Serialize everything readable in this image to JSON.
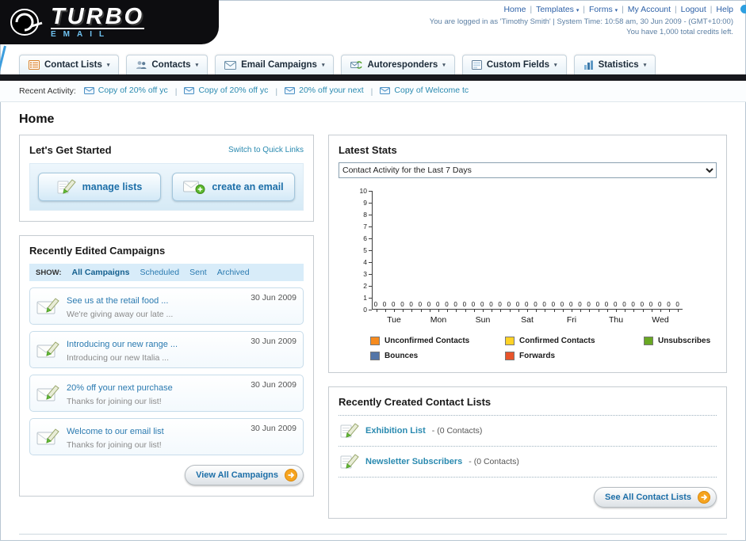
{
  "page_title": "Home",
  "header": {
    "logo_title": "TURBO",
    "logo_subtitle": "EMAIL",
    "nav_links": [
      {
        "label": "Home",
        "dropdown": false
      },
      {
        "label": "Templates",
        "dropdown": true
      },
      {
        "label": "Forms",
        "dropdown": true
      },
      {
        "label": "My Account",
        "dropdown": false
      },
      {
        "label": "Logout",
        "dropdown": false
      },
      {
        "label": "Help",
        "dropdown": false
      }
    ],
    "login_info": "You are logged in as 'Timothy Smith' | System Time: 10:58 am, 30 Jun 2009 - (GMT+10:00)",
    "credits_info": "You have 1,000 total credits left."
  },
  "nav_tabs": [
    {
      "label": "Contact Lists",
      "icon": "contact-lists-icon"
    },
    {
      "label": "Contacts",
      "icon": "contacts-icon"
    },
    {
      "label": "Email Campaigns",
      "icon": "email-campaigns-icon"
    },
    {
      "label": "Autoresponders",
      "icon": "autoresponders-icon"
    },
    {
      "label": "Custom Fields",
      "icon": "custom-fields-icon"
    },
    {
      "label": "Statistics",
      "icon": "statistics-icon"
    }
  ],
  "recent_activity": {
    "label": "Recent Activity:",
    "items": [
      {
        "label": "Copy of 20% off yc",
        "icon": "email-icon"
      },
      {
        "label": "Copy of 20% off yc",
        "icon": "email-icon"
      },
      {
        "label": "20% off your next",
        "icon": "email-icon"
      },
      {
        "label": "Copy of Welcome tc",
        "icon": "email-icon"
      }
    ]
  },
  "get_started": {
    "title": "Let's Get Started",
    "switch_link": "Switch to Quick Links",
    "buttons": [
      {
        "label": "manage lists",
        "icon": "pencil-list-icon"
      },
      {
        "label": "create an email",
        "icon": "envelope-plus-icon"
      }
    ]
  },
  "campaigns": {
    "title": "Recently Edited Campaigns",
    "show_label": "SHOW:",
    "filters": [
      {
        "label": "All Campaigns",
        "active": true
      },
      {
        "label": "Scheduled",
        "active": false
      },
      {
        "label": "Sent",
        "active": false
      },
      {
        "label": "Archived",
        "active": false
      }
    ],
    "items": [
      {
        "title": "See us at the retail food ...",
        "subtitle": "We're giving away our late ...",
        "date": "30 Jun 2009",
        "icon": "envelope-pencil-icon"
      },
      {
        "title": "Introducing our new range ...",
        "subtitle": "Introducing our new Italia ...",
        "date": "30 Jun 2009",
        "icon": "envelope-pencil-icon"
      },
      {
        "title": "20% off your next purchase",
        "subtitle": "Thanks for joining our list!",
        "date": "30 Jun 2009",
        "icon": "envelope-pencil-icon"
      },
      {
        "title": "Welcome to our email list",
        "subtitle": "Thanks for joining our list!",
        "date": "30 Jun 2009",
        "icon": "envelope-pencil-icon"
      }
    ],
    "view_all_label": "View All Campaigns"
  },
  "stats": {
    "title": "Latest Stats",
    "period_selected": "Contact Activity for the Last 7 Days"
  },
  "chart_data": {
    "type": "bar",
    "title": "Contact Activity for the Last 7 Days",
    "categories": [
      "Tue",
      "Mon",
      "Sun",
      "Sat",
      "Fri",
      "Thu",
      "Wed"
    ],
    "series": [
      {
        "name": "Unconfirmed Contacts",
        "color": "#f68b1f",
        "values": [
          0,
          0,
          0,
          0,
          0,
          0,
          0
        ]
      },
      {
        "name": "Confirmed Contacts",
        "color": "#ffd226",
        "values": [
          0,
          0,
          0,
          0,
          0,
          0,
          0
        ]
      },
      {
        "name": "Unsubscribes",
        "color": "#69a823",
        "values": [
          0,
          0,
          0,
          0,
          0,
          0,
          0
        ]
      },
      {
        "name": "Bounces",
        "color": "#5476a8",
        "values": [
          0,
          0,
          0,
          0,
          0,
          0,
          0
        ]
      },
      {
        "name": "Forwards",
        "color": "#e8542a",
        "values": [
          0,
          0,
          0,
          0,
          0,
          0,
          0
        ]
      }
    ],
    "ylim": [
      0,
      10
    ],
    "yticks": [
      0,
      1,
      2,
      3,
      4,
      5,
      6,
      7,
      8,
      9,
      10
    ],
    "value_labels_shown": true,
    "legend_position": "bottom",
    "grid": false
  },
  "contact_lists": {
    "title": "Recently Created Contact Lists",
    "items": [
      {
        "name": "Exhibition List",
        "detail": "- (0 Contacts)",
        "icon": "pencil-icon"
      },
      {
        "name": "Newsletter Subscribers",
        "detail": "- (0 Contacts)",
        "icon": "pencil-icon"
      }
    ],
    "see_all_label": "See All Contact Lists"
  },
  "colors": {
    "link": "#2a7ab0",
    "accent_orange": "#f6a41f",
    "dark_bar": "#17181d"
  }
}
